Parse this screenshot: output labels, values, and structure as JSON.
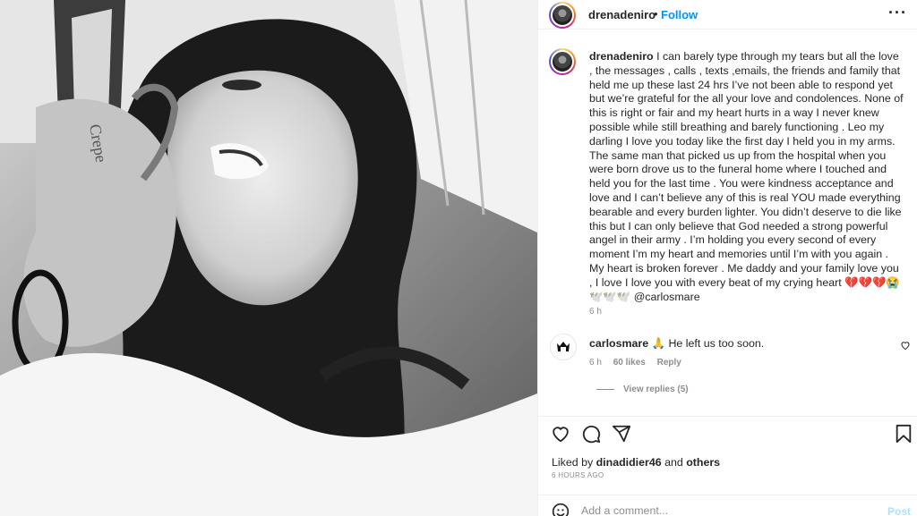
{
  "photo": {
    "icon": "post-photo",
    "description_visible_text": "Crepe"
  },
  "header": {
    "username": "drenadeniro",
    "separator": "•",
    "follow_label": "Follow",
    "more_icon": "more-icon"
  },
  "caption": {
    "username": "drenadeniro",
    "text": "I can barely type through my tears but all the love , the messages , calls , texts ,emails, the friends and family that held me up these last 24 hrs I’ve not been able to respond yet but we’re grateful for the all your love and condolences. None of this is right or fair and my heart hurts in a way I never knew possible while still breathing and barely functioning . Leo my darling I love you today like the first day I held you in my arms. The same man that picked us up from the hospital when you were born drove us to the funeral home where I touched and held you for the last time . You were kindness acceptance and love and I can’t believe any of this is real YOU made everything bearable and every burden lighter. You didn’t deserve to die like this but I can only believe that God needed a strong powerful angel in their army . I’m holding you every second of every moment I’m my heart and memories until I’m with you again . My heart is broken forever . Me daddy and your family love you , I love I love you with every beat of my crying heart 💔💔💔😭 🕊️🕊️🕊️ @carlosmare",
    "time": "6 h"
  },
  "comment": {
    "username": "carlosmare",
    "text": "🙏 He left us too soon.",
    "time": "6 h",
    "likes": "60 likes",
    "reply_label": "Reply",
    "view_replies": "View replies (5)"
  },
  "actions": {
    "like_icon": "heart-icon",
    "comment_icon": "comment-icon",
    "share_icon": "share-icon",
    "save_icon": "bookmark-icon"
  },
  "likes": {
    "prefix": "Liked by",
    "user": "dinadidier46",
    "middle": "and",
    "others": "others"
  },
  "post_time": "6 HOURS AGO",
  "add_comment": {
    "placeholder": "Add a comment...",
    "post_label": "Post"
  }
}
